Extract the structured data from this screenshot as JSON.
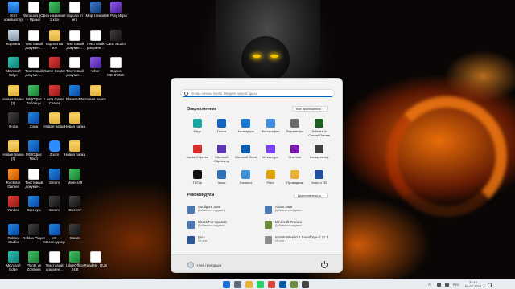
{
  "desktop": {
    "icons": [
      {
        "label": "Этот компьютер",
        "icon": "pc-icon",
        "style": "pc",
        "col": 0,
        "row": 0
      },
      {
        "label": "Windows (C) - Ярлык",
        "icon": "drive-icon",
        "style": "doc",
        "col": 1,
        "row": 0
      },
      {
        "label": "Без названия 1.xlsx",
        "icon": "excel-icon",
        "style": "green",
        "col": 2,
        "row": 0
      },
      {
        "label": "пароли от игр",
        "icon": "document-icon",
        "style": "doc",
        "col": 3,
        "row": 0
      },
      {
        "label": "Мир танков",
        "icon": "game-icon",
        "style": "game",
        "col": 4,
        "row": 0
      },
      {
        "label": "5K Play Игры",
        "icon": "game-icon",
        "style": "purple",
        "col": 5,
        "row": 0
      },
      {
        "label": "Корзина",
        "icon": "recycle-bin-icon",
        "style": "bin",
        "col": 0,
        "row": 1
      },
      {
        "label": "Текстовый докумен...",
        "icon": "document-icon",
        "style": "doc",
        "col": 1,
        "row": 1
      },
      {
        "label": "пароли на всё",
        "icon": "folder-icon",
        "style": "folder",
        "col": 2,
        "row": 1
      },
      {
        "label": "Текстовый докумен...",
        "icon": "document-icon",
        "style": "doc",
        "col": 3,
        "row": 1
      },
      {
        "label": "Текстовый докумен...",
        "icon": "document-icon",
        "style": "doc",
        "col": 4,
        "row": 1
      },
      {
        "label": "OBS Studio",
        "icon": "obs-icon",
        "style": "dark",
        "col": 5,
        "row": 1
      },
      {
        "label": "Microsoft Edge",
        "icon": "edge-icon",
        "style": "teal",
        "col": 0,
        "row": 2
      },
      {
        "label": "Текстовый докумен...",
        "icon": "document-icon",
        "style": "doc",
        "col": 1,
        "row": 2
      },
      {
        "label": "Game Center",
        "icon": "game-center-icon",
        "style": "red",
        "col": 2,
        "row": 2
      },
      {
        "label": "Текстовый докумен...",
        "icon": "document-icon",
        "style": "doc",
        "col": 3,
        "row": 2
      },
      {
        "label": "Viber",
        "icon": "viber-icon",
        "style": "purple",
        "col": 4,
        "row": 2
      },
      {
        "label": "Видео MEHFOLK",
        "icon": "video-icon",
        "style": "doc",
        "col": 5,
        "row": 2
      },
      {
        "label": "Новая папка (2)",
        "icon": "folder-icon",
        "style": "folder",
        "col": 0,
        "row": 3
      },
      {
        "label": "MSIOфис Таблицы",
        "icon": "spreadsheet-icon",
        "style": "green",
        "col": 1,
        "row": 3
      },
      {
        "label": "Lesta Game Center",
        "icon": "lesta-icon",
        "style": "red",
        "col": 2,
        "row": 3
      },
      {
        "label": "PlanetVPN",
        "icon": "vpn-icon",
        "style": "blue",
        "col": 3,
        "row": 3
      },
      {
        "label": "Новая папка",
        "icon": "folder-icon",
        "style": "folder",
        "col": 4,
        "row": 3
      },
      {
        "label": "Hoba",
        "icon": "hoba-icon",
        "style": "dark",
        "col": 0,
        "row": 4
      },
      {
        "label": "Zona",
        "icon": "zona-icon",
        "style": "blue",
        "col": 1,
        "row": 4
      },
      {
        "label": "Новая папка",
        "icon": "folder-icon",
        "style": "folder",
        "col": 2,
        "row": 4
      },
      {
        "label": "Новая папка",
        "icon": "folder-icon",
        "style": "folder",
        "col": 3,
        "row": 4
      },
      {
        "label": "Новая папка (3)",
        "icon": "folder-icon",
        "style": "folder",
        "col": 0,
        "row": 5
      },
      {
        "label": "MSIOфис Текст",
        "icon": "writer-icon",
        "style": "blue",
        "col": 1,
        "row": 5
      },
      {
        "label": "Zoom",
        "icon": "zoom-icon",
        "style": "zoom",
        "col": 2,
        "row": 5
      },
      {
        "label": "Новая папка",
        "icon": "folder-icon",
        "style": "folder",
        "col": 3,
        "row": 5
      },
      {
        "label": "Rockstar Games",
        "icon": "rockstar-icon",
        "style": "orange",
        "col": 0,
        "row": 6
      },
      {
        "label": "Текстовый докумен...",
        "icon": "document-icon",
        "style": "doc",
        "col": 1,
        "row": 6
      },
      {
        "label": "Steam",
        "icon": "steam-icon",
        "style": "blue",
        "col": 2,
        "row": 6
      },
      {
        "label": "Minecraft",
        "icon": "minecraft-icon",
        "style": "green",
        "col": 3,
        "row": 6
      },
      {
        "label": "Yandex",
        "icon": "yandex-icon",
        "style": "red",
        "col": 0,
        "row": 7
      },
      {
        "label": "Сферум",
        "icon": "sferum-icon",
        "style": "blue",
        "col": 1,
        "row": 7
      },
      {
        "label": "Steam",
        "icon": "steam-icon",
        "style": "dark",
        "col": 2,
        "row": 7
      },
      {
        "label": "OpenIV",
        "icon": "openiv-icon",
        "style": "dark",
        "col": 3,
        "row": 7
      },
      {
        "label": "Roblox Studio",
        "icon": "roblox-studio-icon",
        "style": "blue",
        "col": 0,
        "row": 8
      },
      {
        "label": "Roblox Player",
        "icon": "roblox-icon",
        "style": "dark",
        "col": 1,
        "row": 8
      },
      {
        "label": "VK Мессенджер",
        "icon": "vk-icon",
        "style": "blue",
        "col": 2,
        "row": 8
      },
      {
        "label": "Steam",
        "icon": "steam-icon",
        "style": "dark",
        "col": 3,
        "row": 8
      },
      {
        "label": "Microsoft Edge",
        "icon": "edge-icon",
        "style": "teal",
        "col": 0,
        "row": 9
      },
      {
        "label": "Plants vs Zombies",
        "icon": "pvz-icon",
        "style": "green",
        "col": 1,
        "row": 9
      },
      {
        "label": "Текстовый докумен...",
        "icon": "document-icon",
        "style": "doc",
        "col": 2,
        "row": 9
      },
      {
        "label": "LibreOffice 24.8",
        "icon": "libreoffice-icon",
        "style": "green",
        "col": 3,
        "row": 9
      },
      {
        "label": "ReadMe_RUS",
        "icon": "document-icon",
        "style": "doc",
        "col": 4,
        "row": 9
      }
    ]
  },
  "start_menu": {
    "search_placeholder": "Чтобы начать поиск, введите запрос здесь",
    "pinned_title": "Закрепленные",
    "all_apps_label": "Все приложения",
    "pinned": [
      {
        "label": "Edge",
        "icon": "edge-icon",
        "color": "#1aa6a0"
      },
      {
        "label": "Почта",
        "icon": "mail-icon",
        "color": "#1565c0"
      },
      {
        "label": "Календарь",
        "icon": "calendar-icon",
        "color": "#1976d2"
      },
      {
        "label": "Фотографии",
        "icon": "photos-icon",
        "color": "#3f8ee0"
      },
      {
        "label": "Параметры",
        "icon": "gear-icon",
        "color": "#6b6b6b"
      },
      {
        "label": "Solitaire & Casual Games",
        "icon": "solitaire-icon",
        "color": "#1b5e20"
      },
      {
        "label": "Adobe Express",
        "icon": "adobe-express-icon",
        "color": "#d32f2f"
      },
      {
        "label": "Microsoft Clipchamp",
        "icon": "clipchamp-icon",
        "color": "#5e35b1"
      },
      {
        "label": "Microsoft Store",
        "icon": "store-icon",
        "color": "#0b5cad"
      },
      {
        "label": "Messenger",
        "icon": "messenger-icon",
        "color": "#7b3ff2"
      },
      {
        "label": "OneNote",
        "icon": "onenote-icon",
        "color": "#7719aa"
      },
      {
        "label": "Калькулятор",
        "icon": "calculator-icon",
        "color": "#404040"
      },
      {
        "label": "TikTok",
        "icon": "tiktok-icon",
        "color": "#111111"
      },
      {
        "label": "Часы",
        "icon": "clock-icon",
        "color": "#2f6fb5"
      },
      {
        "label": "Блокнот",
        "icon": "notepad-icon",
        "color": "#3d8fd6"
      },
      {
        "label": "Paint",
        "icon": "paint-icon",
        "color": "#e0a100"
      },
      {
        "label": "Проводник",
        "icon": "explorer-icon",
        "color": "#e8b23a"
      },
      {
        "label": "Кино и ТВ",
        "icon": "movies-icon",
        "color": "#1e4fa0"
      }
    ],
    "recommended_title": "Рекомендуем",
    "more_label": "Дополнительно",
    "recommended": [
      {
        "title": "Configure Java",
        "subtitle": "Добавлено недавно",
        "icon": "java-icon",
        "color": "#4a78b5"
      },
      {
        "title": "About Java",
        "subtitle": "Добавлено недавно",
        "icon": "java-icon",
        "color": "#4a78b5"
      },
      {
        "title": "Check For Updates",
        "subtitle": "Добавлено недавно",
        "icon": "java-icon",
        "color": "#4a78b5"
      },
      {
        "title": "Minecraft Preview",
        "subtitle": "Добавлено недавно",
        "icon": "minecraft-icon",
        "color": "#6a8d3a"
      },
      {
        "title": "pack",
        "subtitle": "25 ноя.",
        "icon": "word-doc-icon",
        "color": "#2b579a"
      },
      {
        "title": "monstrosteel-0.2.1-neoforge-1.21.1",
        "subtitle": "25 ноя.",
        "icon": "file-icon",
        "color": "#8a8a8a"
      }
    ],
    "user_name": "глеб григорьев"
  },
  "taskbar": {
    "apps": [
      {
        "icon": "windows-start-icon",
        "color": "#1e6fd9"
      },
      {
        "icon": "search-icon",
        "color": "#5f6b78"
      },
      {
        "icon": "file-explorer-icon",
        "color": "#e8b23a"
      },
      {
        "icon": "whatsapp-icon",
        "color": "#25d366"
      },
      {
        "icon": "chrome-icon",
        "color": "#db4437"
      },
      {
        "icon": "store-icon",
        "color": "#0b5cad"
      },
      {
        "icon": "minecraft-icon",
        "color": "#6a8d3a"
      },
      {
        "icon": "app-icon",
        "color": "#444444"
      }
    ],
    "language": "РУС",
    "time": "23:16",
    "date": "03.02.2025"
  }
}
